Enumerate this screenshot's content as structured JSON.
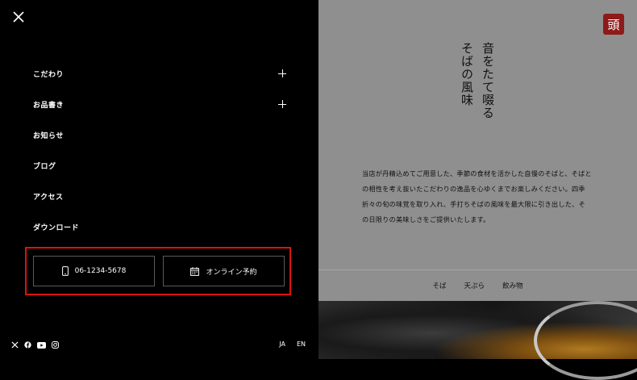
{
  "menu": {
    "items": [
      {
        "label": "こだわり",
        "expandable": true
      },
      {
        "label": "お品書き",
        "expandable": true
      },
      {
        "label": "お知らせ",
        "expandable": false
      },
      {
        "label": "ブログ",
        "expandable": false
      },
      {
        "label": "アクセス",
        "expandable": false
      },
      {
        "label": "ダウンロード",
        "expandable": false
      }
    ],
    "phone_label": "06-1234-5678",
    "reserve_label": "オンライン予約",
    "social_icons": [
      "x-icon",
      "facebook-icon",
      "youtube-icon",
      "instagram-icon"
    ],
    "lang": {
      "ja": "JA",
      "en": "EN"
    }
  },
  "content": {
    "logo_char": "頭",
    "title": "音をたて啜る\nそばの風味",
    "title_line1": "音をたて啜る",
    "title_line2": "そばの風味",
    "description": "当店が丹精込めてご用意した、季節の食材を活かした自慢のそばと、そばとの相性を考え抜いたこだわりの逸品を心ゆくまでお楽しみください。四季折々の旬の味覚を取り入れ、手打ちそばの風味を最大限に引き出した、その日限りの美味しさをご提供いたします。",
    "subnav": [
      "そば",
      "天ぷら",
      "飲み物"
    ]
  },
  "colors": {
    "accent_red": "#d11111",
    "logo_bg": "#8e1a1a",
    "panel_bg": "#8f8f8f"
  }
}
